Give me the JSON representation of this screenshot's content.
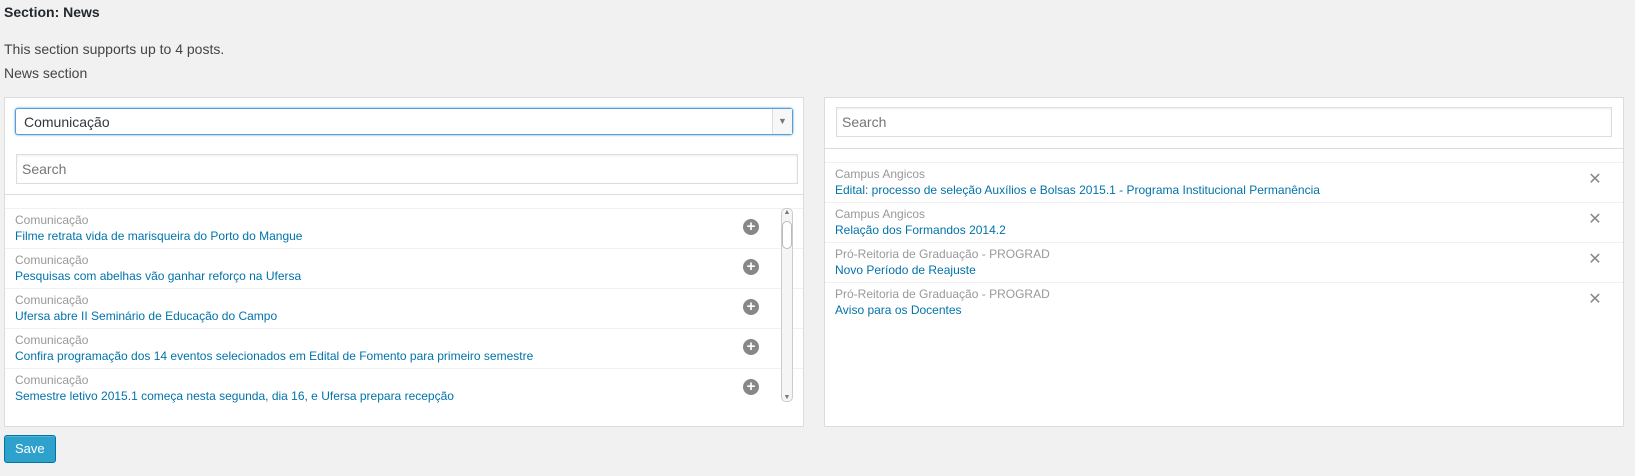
{
  "section": {
    "title": "Section: News",
    "intro": "This section supports up to 4 posts.",
    "subhead": "News section"
  },
  "left_panel": {
    "category_select": {
      "selected": "Comunicação"
    },
    "search": {
      "placeholder": "Search"
    },
    "items": [
      {
        "category": "Comunicação",
        "title": "Filme retrata vida de marisqueira do Porto do Mangue"
      },
      {
        "category": "Comunicação",
        "title": "Pesquisas com abelhas vão ganhar reforço na Ufersa"
      },
      {
        "category": "Comunicação",
        "title": "Ufersa abre II Seminário de Educação do Campo"
      },
      {
        "category": "Comunicação",
        "title": "Confira programação dos 14 eventos selecionados em Edital de Fomento para primeiro semestre"
      },
      {
        "category": "Comunicação",
        "title": "Semestre letivo 2015.1 começa nesta segunda, dia 16, e Ufersa prepara recepção"
      }
    ],
    "add_icon": "plus-circle-icon"
  },
  "right_panel": {
    "search": {
      "placeholder": "Search"
    },
    "items": [
      {
        "category": "Campus Angicos",
        "title": "Edital: processo de seleção Auxílios e Bolsas 2015.1 - Programa Institucional Permanência"
      },
      {
        "category": "Campus Angicos",
        "title": "Relação dos Formandos 2014.2"
      },
      {
        "category": "Pró-Reitoria de Graduação - PROGRAD",
        "title": "Novo Período de Reajuste"
      },
      {
        "category": "Pró-Reitoria de Graduação - PROGRAD",
        "title": "Aviso para os Docentes"
      }
    ],
    "remove_icon": "close-x-icon"
  },
  "save_label": "Save",
  "colors": {
    "link": "#0073aa",
    "button": "#2ea2cc",
    "focus": "#5b9dd9"
  }
}
